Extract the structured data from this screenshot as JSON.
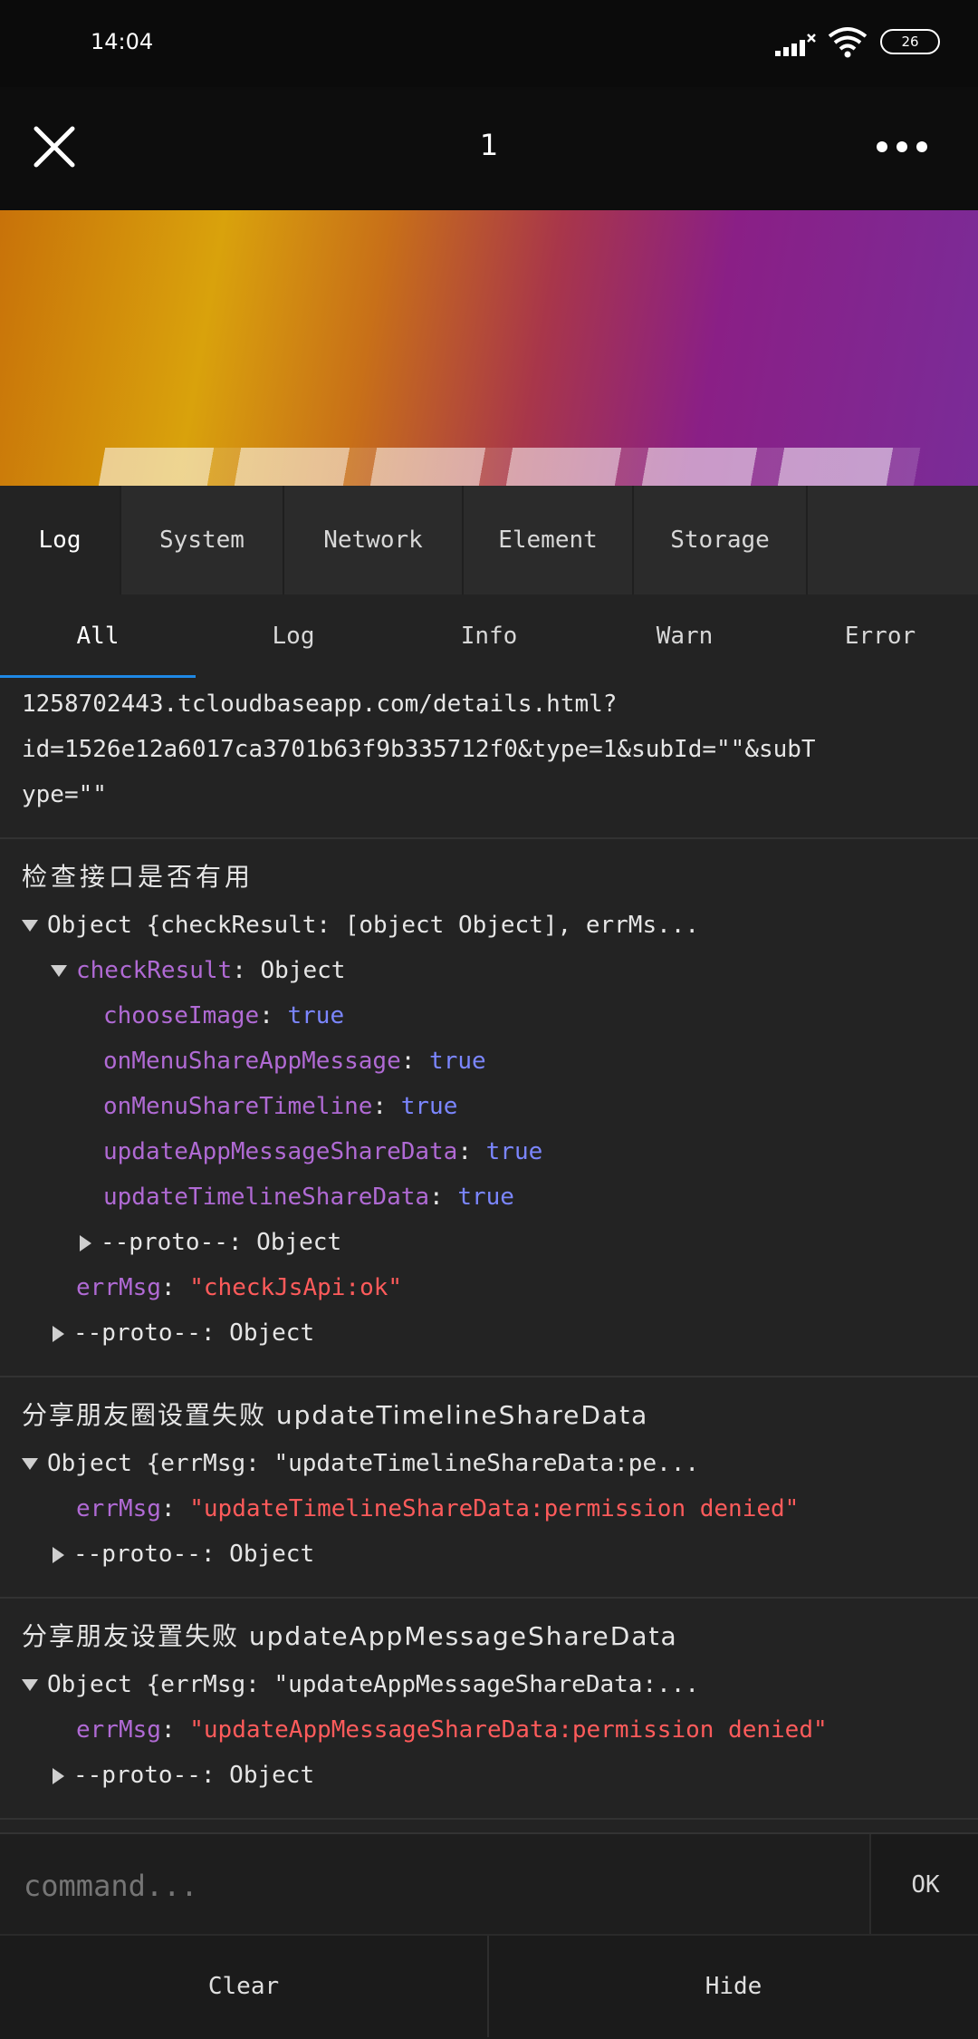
{
  "status_bar": {
    "time": "14:04",
    "battery": "26",
    "icons": [
      "signal-icon",
      "wifi-icon",
      "battery-icon"
    ]
  },
  "nav": {
    "title": "1",
    "icons": [
      "close-icon",
      "more-icon"
    ]
  },
  "tabs": [
    {
      "label": "Log",
      "active": true
    },
    {
      "label": "System",
      "active": false
    },
    {
      "label": "Network",
      "active": false
    },
    {
      "label": "Element",
      "active": false
    },
    {
      "label": "Storage",
      "active": false
    }
  ],
  "subtabs": [
    {
      "label": "All",
      "active": true
    },
    {
      "label": "Log",
      "active": false
    },
    {
      "label": "Info",
      "active": false
    },
    {
      "label": "Warn",
      "active": false
    },
    {
      "label": "Error",
      "active": false
    }
  ],
  "entries": [
    {
      "lines": [
        "1258702443.tcloudbaseapp.com/details.html?",
        "id=1526e12a6017ca3701b63f9b335712f0&type=1&subId=\"\"&subT",
        "ype=\"\""
      ]
    },
    {
      "title": "检查接口是否有用",
      "object_summary": "Object {checkResult: [object Object], errMs...",
      "check_result_key": "checkResult",
      "check_result_value": ": Object",
      "props": [
        {
          "key": "chooseImage",
          "value": "true"
        },
        {
          "key": "onMenuShareAppMessage",
          "value": "true"
        },
        {
          "key": "onMenuShareTimeline",
          "value": "true"
        },
        {
          "key": "updateAppMessageShareData",
          "value": "true"
        },
        {
          "key": "updateTimelineShareData",
          "value": "true"
        }
      ],
      "inner_proto": "--proto--: Object",
      "errmsg_key": "errMsg",
      "errmsg_value": "\"checkJsApi:ok\"",
      "outer_proto": "--proto--: Object"
    },
    {
      "title": "分享朋友圈设置失败 updateTimelineShareData",
      "object_summary": "Object {errMsg: \"updateTimelineShareData:pe...",
      "errmsg_key": "errMsg",
      "errmsg_value": "\"updateTimelineShareData:permission denied\"",
      "proto": "--proto--: Object"
    },
    {
      "title": "分享朋友设置失败 updateAppMessageShareData",
      "object_summary": "Object {errMsg: \"updateAppMessageShareData:...",
      "errmsg_key": "errMsg",
      "errmsg_value": "\"updateAppMessageShareData:permission denied\"",
      "proto": "--proto--: Object"
    }
  ],
  "command": {
    "placeholder": "command...",
    "ok_label": "OK"
  },
  "bottom": {
    "clear_label": "Clear",
    "hide_label": "Hide"
  },
  "colors": {
    "tab_indicator": "#1e88e5",
    "key_purple": "#b06ad4",
    "value_blue": "#7b86ff",
    "error_red": "#ff5b5b"
  }
}
